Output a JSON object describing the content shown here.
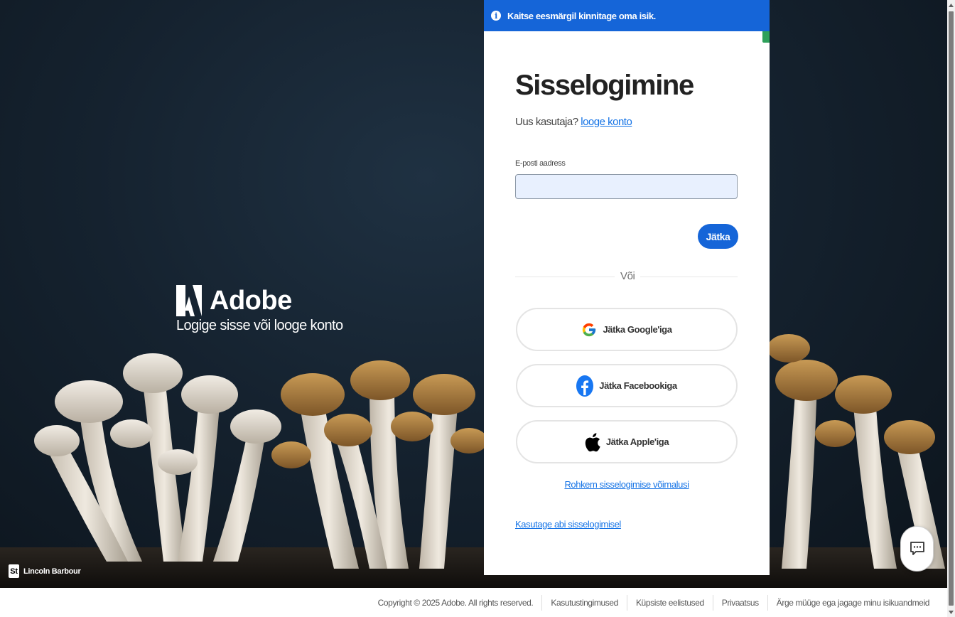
{
  "banner": {
    "text": "Kaitse eesmärgil kinnitage oma isik.",
    "icon": "info-icon"
  },
  "brand": {
    "name": "Adobe",
    "tagline": "Logige sisse või looge konto"
  },
  "credit": {
    "badge": "St",
    "author": "Lincoln Barbour"
  },
  "signin": {
    "title": "Sisselogimine",
    "new_user_prompt": "Uus kasutaja?",
    "create_account_link": "looge konto",
    "email_label": "E-posti aadress",
    "email_value": "",
    "continue_label": "Jätka",
    "or_label": "Või",
    "social": [
      {
        "label": "Jätka Google'iga",
        "icon": "google-icon"
      },
      {
        "label": "Jätka Facebookiga",
        "icon": "facebook-icon"
      },
      {
        "label": "Jätka Apple'iga",
        "icon": "apple-icon"
      }
    ],
    "more_options_link": "Rohkem sisselogimise võimalusi",
    "help_link": "Kasutage abi sisselogimisel"
  },
  "footer": {
    "copyright": "Copyright © 2025 Adobe. All rights reserved.",
    "links": [
      "Kasutustingimused",
      "Küpsiste eelistused",
      "Privaatsus",
      "Ärge müüge ega jagage minu isikuandmeid"
    ]
  },
  "colors": {
    "accent": "#1565d8",
    "link": "#1473e6",
    "background": "#15222f"
  }
}
